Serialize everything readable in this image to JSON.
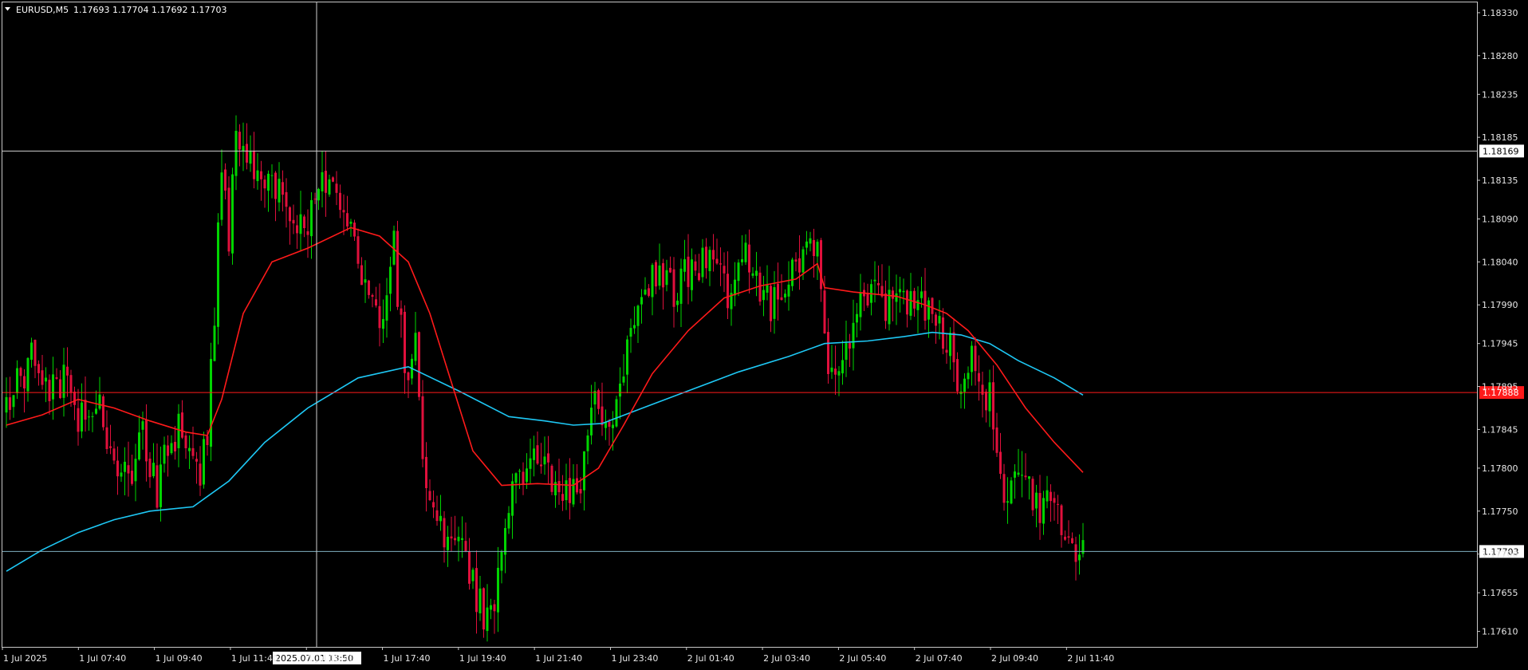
{
  "header": {
    "symbol": "EURUSD,M5",
    "ohlc": "1.17693 1.17704 1.17692 1.17703"
  },
  "crosshair": {
    "time_label": "2025.07.01 13:50",
    "price_label": "1.18169",
    "price": 1.18169
  },
  "colors": {
    "background": "#000000",
    "frame": "#c8c8c8",
    "bull": "#00d400",
    "bear": "#e0103c",
    "ma_fast": "#ff1a1a",
    "ma_slow": "#1ec8f5",
    "red_level": "#ff1a1a",
    "bid_level": "#7fb0c0",
    "crosshair": "#d0d0d0"
  },
  "chart_data": {
    "type": "candlestick",
    "title": "EURUSD,M5",
    "y_axis": {
      "ticks": [
        1.1833,
        1.1828,
        1.18235,
        1.18185,
        1.18135,
        1.1809,
        1.1804,
        1.1799,
        1.17945,
        1.17895,
        1.17845,
        1.178,
        1.1775,
        1.177,
        1.17655,
        1.1761
      ],
      "tick_labels": [
        "1.18330",
        "1.18280",
        "1.18235",
        "1.18185",
        "1.18135",
        "1.18090",
        "1.18040",
        "1.17990",
        "1.17945",
        "1.17895",
        "1.17845",
        "1.17800",
        "1.17750",
        "1.17700",
        "1.17655",
        "1.17610"
      ],
      "range": [
        1.17592,
        1.18342
      ]
    },
    "x_axis": {
      "tick_labels": [
        "1 Jul 2025",
        "1 Jul 07:40",
        "1 Jul 09:40",
        "1 Jul 11:40",
        "1 Jul 15:40",
        "1 Jul 17:40",
        "1 Jul 19:40",
        "1 Jul 21:40",
        "1 Jul 23:40",
        "2 Jul 01:40",
        "2 Jul 03:40",
        "2 Jul 05:40",
        "2 Jul 07:40",
        "2 Jul 09:40",
        "2 Jul 11:40"
      ],
      "bar_count": 300
    },
    "levels": [
      {
        "name": "red-level",
        "price": 1.17888,
        "label": "1.17888"
      },
      {
        "name": "bid-level",
        "price": 1.17703,
        "label": "1.17703"
      }
    ],
    "ma_fast": [
      [
        0,
        1.1785
      ],
      [
        10,
        1.17862
      ],
      [
        20,
        1.1788
      ],
      [
        30,
        1.1787
      ],
      [
        40,
        1.17855
      ],
      [
        50,
        1.17842
      ],
      [
        56,
        1.17838
      ],
      [
        60,
        1.1788
      ],
      [
        66,
        1.1798
      ],
      [
        74,
        1.1804
      ],
      [
        84,
        1.18056
      ],
      [
        96,
        1.1808
      ],
      [
        104,
        1.1807
      ],
      [
        112,
        1.1804
      ],
      [
        118,
        1.1798
      ],
      [
        124,
        1.179
      ],
      [
        130,
        1.1782
      ],
      [
        138,
        1.1778
      ],
      [
        148,
        1.17782
      ],
      [
        158,
        1.1778
      ],
      [
        165,
        1.178
      ],
      [
        172,
        1.1785
      ],
      [
        180,
        1.1791
      ],
      [
        190,
        1.1796
      ],
      [
        200,
        1.17998
      ],
      [
        210,
        1.18012
      ],
      [
        220,
        1.1802
      ],
      [
        226,
        1.18038
      ],
      [
        228,
        1.1801
      ],
      [
        236,
        1.18005
      ],
      [
        248,
        1.18
      ],
      [
        256,
        1.1799
      ],
      [
        262,
        1.1798
      ],
      [
        268,
        1.1796
      ],
      [
        276,
        1.1792
      ],
      [
        284,
        1.1787
      ],
      [
        292,
        1.1783
      ],
      [
        300,
        1.17795
      ]
    ],
    "ma_slow": [
      [
        0,
        1.1768
      ],
      [
        10,
        1.17705
      ],
      [
        20,
        1.17725
      ],
      [
        30,
        1.1774
      ],
      [
        40,
        1.1775
      ],
      [
        52,
        1.17755
      ],
      [
        62,
        1.17785
      ],
      [
        72,
        1.1783
      ],
      [
        84,
        1.1787
      ],
      [
        98,
        1.17905
      ],
      [
        112,
        1.17918
      ],
      [
        126,
        1.1789
      ],
      [
        140,
        1.1786
      ],
      [
        150,
        1.17855
      ],
      [
        158,
        1.1785
      ],
      [
        166,
        1.17852
      ],
      [
        176,
        1.17868
      ],
      [
        190,
        1.1789
      ],
      [
        204,
        1.17912
      ],
      [
        218,
        1.1793
      ],
      [
        228,
        1.17945
      ],
      [
        240,
        1.17948
      ],
      [
        250,
        1.17953
      ],
      [
        258,
        1.17958
      ],
      [
        266,
        1.17955
      ],
      [
        274,
        1.17945
      ],
      [
        282,
        1.17925
      ],
      [
        292,
        1.17905
      ],
      [
        300,
        1.17885
      ]
    ],
    "anchors": [
      [
        0,
        1.17865
      ],
      [
        4,
        1.17905
      ],
      [
        8,
        1.1793
      ],
      [
        12,
        1.17895
      ],
      [
        16,
        1.17905
      ],
      [
        20,
        1.1786
      ],
      [
        26,
        1.17865
      ],
      [
        30,
        1.1782
      ],
      [
        34,
        1.1779
      ],
      [
        38,
        1.17835
      ],
      [
        42,
        1.17775
      ],
      [
        46,
        1.1784
      ],
      [
        50,
        1.17845
      ],
      [
        54,
        1.178
      ],
      [
        56,
        1.17845
      ],
      [
        58,
        1.1798
      ],
      [
        60,
        1.1815
      ],
      [
        62,
        1.1807
      ],
      [
        64,
        1.182
      ],
      [
        66,
        1.1818
      ],
      [
        70,
        1.1813
      ],
      [
        74,
        1.1814
      ],
      [
        80,
        1.181
      ],
      [
        84,
        1.1807
      ],
      [
        88,
        1.1815
      ],
      [
        92,
        1.1812
      ],
      [
        96,
        1.1808
      ],
      [
        100,
        1.1802
      ],
      [
        104,
        1.1796
      ],
      [
        108,
        1.1806
      ],
      [
        110,
        1.1796
      ],
      [
        112,
        1.1789
      ],
      [
        114,
        1.1794
      ],
      [
        116,
        1.1783
      ],
      [
        118,
        1.1776
      ],
      [
        122,
        1.1772
      ],
      [
        126,
        1.1773
      ],
      [
        130,
        1.1766
      ],
      [
        132,
        1.1764
      ],
      [
        134,
        1.1762
      ],
      [
        136,
        1.1765
      ],
      [
        138,
        1.177
      ],
      [
        140,
        1.1775
      ],
      [
        142,
        1.1779
      ],
      [
        146,
        1.178
      ],
      [
        150,
        1.1781
      ],
      [
        152,
        1.1778
      ],
      [
        156,
        1.1777
      ],
      [
        160,
        1.1779
      ],
      [
        162,
        1.1784
      ],
      [
        164,
        1.1787
      ],
      [
        166,
        1.1784
      ],
      [
        170,
        1.1788
      ],
      [
        174,
        1.1796
      ],
      [
        178,
        1.18
      ],
      [
        182,
        1.1804
      ],
      [
        186,
        1.1801
      ],
      [
        190,
        1.1803
      ],
      [
        194,
        1.1804
      ],
      [
        198,
        1.1803
      ],
      [
        202,
        1.18
      ],
      [
        206,
        1.1804
      ],
      [
        210,
        1.18
      ],
      [
        214,
        1.1799
      ],
      [
        218,
        1.1802
      ],
      [
        222,
        1.1806
      ],
      [
        226,
        1.1807
      ],
      [
        228,
        1.1795
      ],
      [
        230,
        1.1791
      ],
      [
        234,
        1.1795
      ],
      [
        238,
        1.17985
      ],
      [
        242,
        1.18
      ],
      [
        246,
        1.1799
      ],
      [
        250,
        1.17995
      ],
      [
        254,
        1.18
      ],
      [
        258,
        1.1798
      ],
      [
        262,
        1.17955
      ],
      [
        264,
        1.1792
      ],
      [
        266,
        1.1788
      ],
      [
        268,
        1.1791
      ],
      [
        270,
        1.1793
      ],
      [
        272,
        1.1787
      ],
      [
        274,
        1.1789
      ],
      [
        276,
        1.1782
      ],
      [
        278,
        1.1778
      ],
      [
        282,
        1.1779
      ],
      [
        286,
        1.1777
      ],
      [
        288,
        1.1775
      ],
      [
        292,
        1.1776
      ],
      [
        296,
        1.1772
      ],
      [
        298,
        1.1769
      ],
      [
        300,
        1.17703
      ]
    ]
  }
}
